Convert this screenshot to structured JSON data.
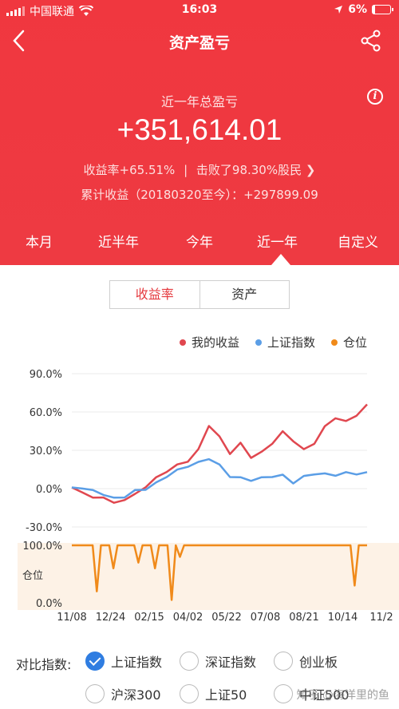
{
  "status": {
    "carrier": "中国联通",
    "time": "16:03",
    "battery": "6%"
  },
  "nav": {
    "title": "资产盈亏"
  },
  "summary": {
    "period_label": "近一年总盈亏",
    "total": "+351,614.01",
    "return_rate": "收益率+65.51%",
    "separator": "|",
    "beat": "击败了98.30%股民",
    "cumulative": "累计收益（20180320至今）：+297899.09"
  },
  "tabs": [
    "本月",
    "近半年",
    "今年",
    "近一年",
    "自定义"
  ],
  "active_tab": "近一年",
  "segment": {
    "rate": "收益率",
    "asset": "资产"
  },
  "legend": [
    {
      "label": "我的收益",
      "color": "#e0474f"
    },
    {
      "label": "上证指数",
      "color": "#5b9ee6"
    },
    {
      "label": "仓位",
      "color": "#f08a1a"
    }
  ],
  "chart_data": {
    "type": "line",
    "x_tick_labels": [
      "11/08",
      "12/24",
      "02/15",
      "04/02",
      "05/22",
      "07/08",
      "08/21",
      "10/14",
      "11/2"
    ],
    "y_tick_labels": [
      "90.0%",
      "60.0%",
      "30.0%",
      "0.0%",
      "-30.0%"
    ],
    "ylim": [
      -30,
      90
    ],
    "series": [
      {
        "name": "我的收益",
        "color": "#e0474f",
        "values": [
          0,
          -2,
          -8,
          -6,
          -12,
          -8,
          -5,
          2,
          8,
          14,
          18,
          22,
          30,
          50,
          40,
          28,
          35,
          25,
          28,
          36,
          44,
          38,
          30,
          36,
          48,
          56,
          52,
          58,
          65
        ]
      },
      {
        "name": "上证指数",
        "color": "#5b9ee6",
        "values": [
          0,
          1,
          -2,
          -4,
          -8,
          -6,
          -2,
          0,
          4,
          10,
          14,
          18,
          20,
          24,
          18,
          10,
          8,
          7,
          8,
          10,
          10,
          5,
          9,
          12,
          11,
          11,
          12,
          12,
          12
        ]
      }
    ],
    "position": {
      "name": "仓位",
      "color": "#f08a1a",
      "ylabel": "仓位",
      "y_tick_labels": [
        "100.0%",
        "0.0%"
      ],
      "values": [
        100,
        100,
        100,
        100,
        100,
        100,
        20,
        100,
        100,
        100,
        60,
        100,
        100,
        100,
        100,
        100,
        70,
        100,
        100,
        100,
        60,
        100,
        100,
        100,
        5,
        100,
        80,
        100,
        100,
        100,
        100,
        100,
        100,
        100,
        100,
        100,
        100,
        100,
        100,
        100,
        100,
        100,
        100,
        100,
        100,
        100,
        100,
        100,
        100,
        100,
        100,
        100,
        100,
        100,
        100,
        100,
        100,
        100,
        100,
        100,
        100,
        100,
        100,
        100,
        100,
        100,
        100,
        100,
        30,
        100,
        100,
        100
      ]
    }
  },
  "compare": {
    "label": "对比指数:",
    "options": [
      "上证指数",
      "深证指数",
      "创业板",
      "沪深300",
      "上证50",
      "中证500"
    ],
    "selected": "上证指数"
  },
  "watermark": "知乎 @海洋里的鱼"
}
